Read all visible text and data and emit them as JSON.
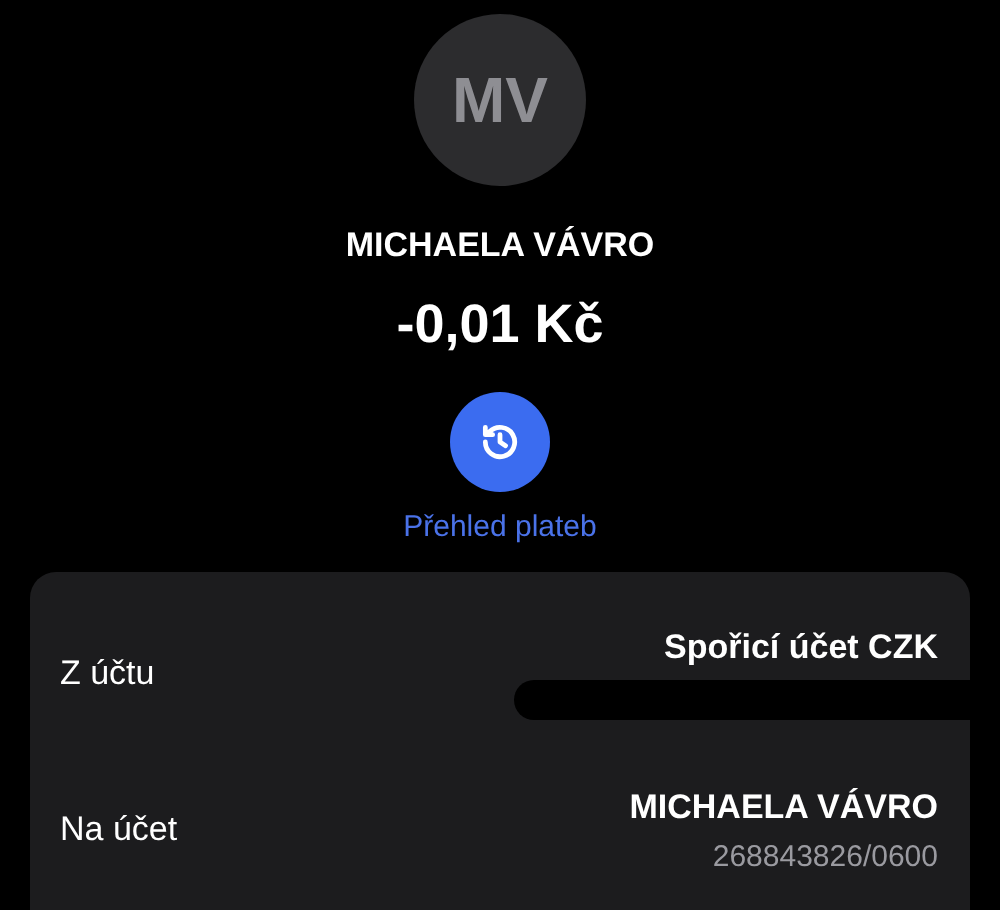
{
  "header": {
    "avatar_initials": "MV",
    "name": "MICHAELA VÁVRO",
    "amount": "-0,01 Kč",
    "history_link": "Přehled plateb"
  },
  "details": [
    {
      "kind": "redacted",
      "label": "Z účtu",
      "title": "Spořicí účet CZK"
    },
    {
      "kind": "account",
      "label": "Na účet",
      "title": "MICHAELA VÁVRO",
      "account": "268843826/0600"
    }
  ]
}
